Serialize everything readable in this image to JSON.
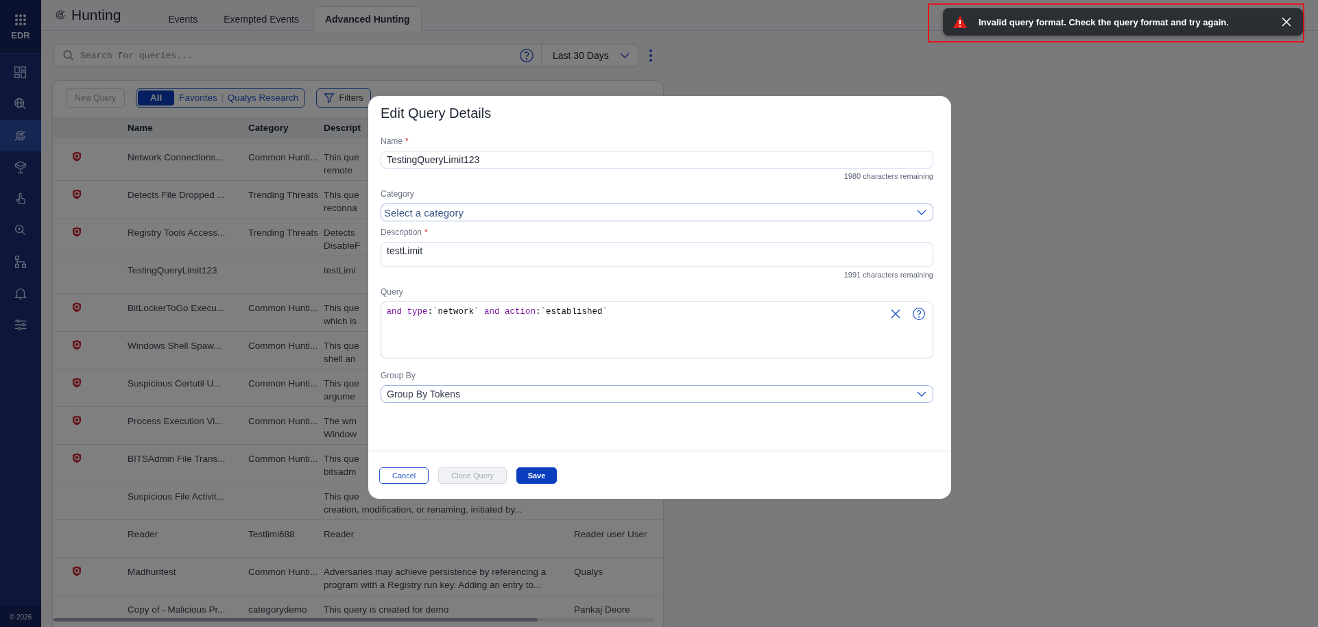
{
  "sidebar": {
    "app_label": "EDR",
    "items": [
      {
        "kind": "layout",
        "selected": false
      },
      {
        "kind": "globe",
        "selected": false
      },
      {
        "kind": "radar",
        "selected": true
      },
      {
        "kind": "cube",
        "selected": false
      },
      {
        "kind": "pointer",
        "selected": false
      },
      {
        "kind": "bug",
        "selected": false
      },
      {
        "kind": "tree",
        "selected": false
      },
      {
        "kind": "bell",
        "selected": false
      },
      {
        "kind": "sliders",
        "selected": false
      }
    ],
    "footer": "© 2026"
  },
  "header": {
    "title": "Hunting",
    "tabs": [
      {
        "label": "Events",
        "selected": false
      },
      {
        "label": "Exempted Events",
        "selected": false
      },
      {
        "label": "Advanced Hunting",
        "selected": true
      }
    ]
  },
  "search": {
    "placeholder": "Search for queries...",
    "date_range": "Last 30 Days"
  },
  "toolbar": {
    "new_query": {
      "label": "New Query",
      "disabled": true
    },
    "segments": [
      {
        "label": "All",
        "selected": true
      },
      {
        "label": "Favorites",
        "selected": false
      },
      {
        "label": "Qualys Research",
        "selected": false
      }
    ],
    "filters": "Filters"
  },
  "table": {
    "columns": [
      "Name",
      "Category",
      "Descript"
    ],
    "rows": [
      {
        "flagged": true,
        "name": "Network Connections...",
        "category": "Common Hunti...",
        "description": [
          "This que",
          "remote"
        ]
      },
      {
        "flagged": true,
        "name": "Detects File Dropped ...",
        "category": "Trending Threats",
        "description": [
          "This que",
          "reconna"
        ]
      },
      {
        "flagged": true,
        "name": "Registry Tools Access...",
        "category": "Trending Threats",
        "description": [
          "Detects",
          "DisableF"
        ]
      },
      {
        "flagged": false,
        "name": "TestingQueryLimit123",
        "description": [
          "testLimi"
        ]
      },
      {
        "flagged": true,
        "name": "BitLockerToGo Execu...",
        "category": "Common Hunti...",
        "description": [
          "This que",
          "which is"
        ]
      },
      {
        "flagged": true,
        "name": "Windows Shell Spaw...",
        "category": "Common Hunti...",
        "description": [
          "This que",
          "shell an"
        ]
      },
      {
        "flagged": true,
        "name": "Suspicious Certutil U...",
        "category": "Common Hunti...",
        "description": [
          "This que",
          "argume"
        ]
      },
      {
        "flagged": true,
        "name": "Process Execution Vi...",
        "category": "Common Hunti...",
        "description": [
          "The wm",
          "Window"
        ]
      },
      {
        "flagged": true,
        "name": "BITSAdmin File Trans...",
        "category": "Common Hunti...",
        "description": [
          "This que",
          "bitsadm"
        ]
      },
      {
        "flagged": false,
        "name": "Suspicious File Activit...",
        "description": [
          "This que",
          "creation, modification, or renaming, initiated by..."
        ]
      },
      {
        "flagged": false,
        "name": "Reader",
        "category": "Testlimi688",
        "description": [
          "Reader"
        ],
        "column_5": "Reader user User"
      },
      {
        "flagged": true,
        "name": "Madhuritest",
        "category": "Common Hunti...",
        "description": [
          "Adversaries may achieve persistence by referencing a",
          "program with a Registry run key. Adding an entry to..."
        ],
        "column_5": "Qualys"
      },
      {
        "flagged": false,
        "name": "Copy of - Malicious Pr...",
        "category": "categorydemo",
        "description": [
          "This query is created for demo"
        ],
        "column_5": "Pankaj Deore"
      }
    ]
  },
  "dialog": {
    "title": "Edit Query Details",
    "name": {
      "label": "Name",
      "required_mark": "*",
      "value": "TestingQueryLimit123",
      "counter": "1980 characters remaining"
    },
    "category": {
      "label": "Category",
      "placeholder": "Select a category"
    },
    "description": {
      "label": "Description",
      "required_mark": "*",
      "value": "testLimit",
      "counter": "1991 characters remaining"
    },
    "query": {
      "label": "Query",
      "tokens": [
        {
          "text": "and",
          "kind": "keyword",
          "joined": false
        },
        {
          "text": "type",
          "kind": "keyword",
          "joined": false
        },
        {
          "text": ":`network`",
          "kind": "plain",
          "joined": true
        },
        {
          "text": "and",
          "kind": "keyword",
          "joined": false
        },
        {
          "text": "action",
          "kind": "keyword",
          "joined": false
        },
        {
          "text": ":`established`",
          "kind": "plain",
          "joined": true
        }
      ]
    },
    "group_by": {
      "label": "Group By",
      "value": "Group By Tokens"
    },
    "buttons": [
      {
        "label": "Cancel",
        "kind": "outline",
        "disabled": false
      },
      {
        "label": "Clone Query",
        "kind": "outline",
        "disabled": true
      },
      {
        "label": "Save",
        "kind": "primary",
        "disabled": false
      }
    ]
  },
  "toast": {
    "message": "Invalid query format. Check the query format and try again."
  }
}
